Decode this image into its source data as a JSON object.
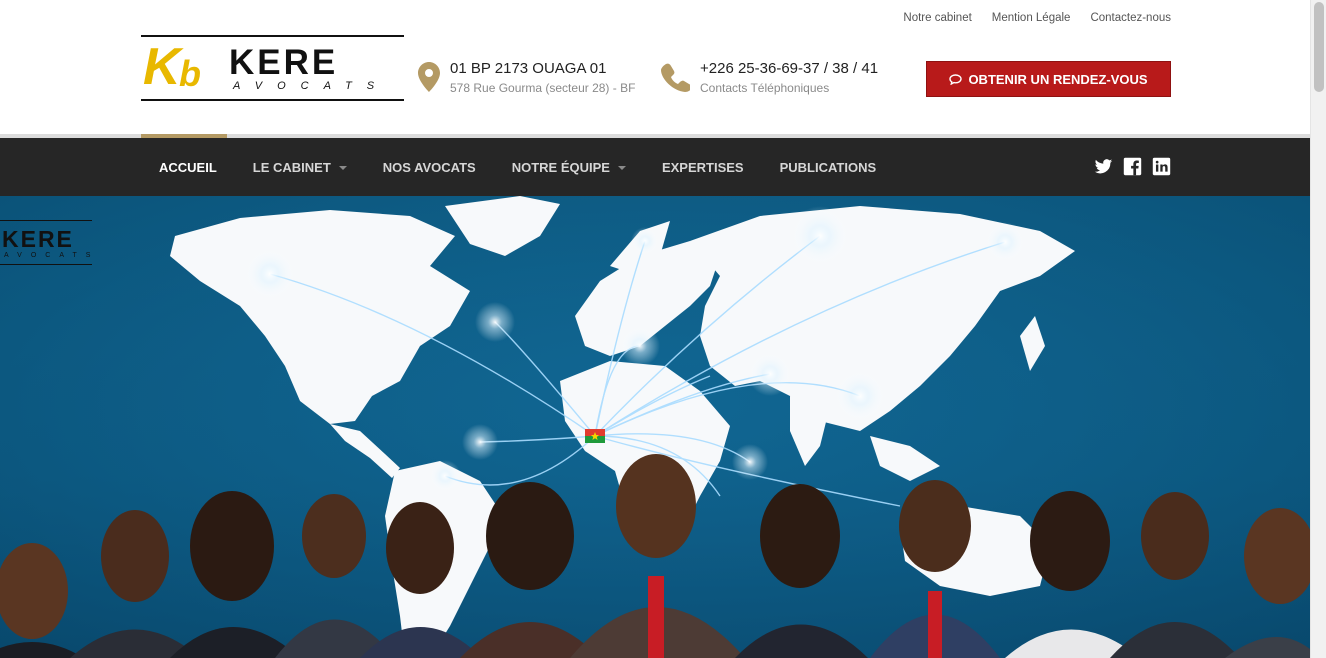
{
  "topbar": {
    "links": [
      "Notre cabinet",
      "Mention Légale",
      "Contactez-nous"
    ]
  },
  "logo": {
    "mark": "Kb",
    "name": "KERE",
    "tagline": "AVOCATS"
  },
  "address": {
    "icon": "map-marker-icon",
    "main": "01 BP 2173 OUAGA 01",
    "sub": "578 Rue Gourma (secteur 28) - BF"
  },
  "phone": {
    "icon": "phone-icon",
    "main": "+226 25-36-69-37 / 38 / 41",
    "sub": "Contacts Téléphoniques"
  },
  "cta": {
    "icon": "chat-bubble-icon",
    "label": "OBTENIR UN RENDEZ-VOUS"
  },
  "nav": {
    "items": [
      {
        "label": "ACCUEIL",
        "active": true,
        "dropdown": false
      },
      {
        "label": "LE CABINET",
        "active": false,
        "dropdown": true
      },
      {
        "label": "NOS AVOCATS",
        "active": false,
        "dropdown": false
      },
      {
        "label": "NOTRE ÉQUIPE",
        "active": false,
        "dropdown": true
      },
      {
        "label": "EXPERTISES",
        "active": false,
        "dropdown": false
      },
      {
        "label": "PUBLICATIONS",
        "active": false,
        "dropdown": false
      }
    ],
    "social": [
      "twitter-icon",
      "facebook-icon",
      "linkedin-icon"
    ]
  },
  "hero": {
    "logo_name": "KERE",
    "logo_tagline": "AVOCATS"
  },
  "colors": {
    "brand_gold": "#e8b800",
    "accent_red": "#b81a1a",
    "nav_bg": "#262626",
    "active_underline": "#b49a64",
    "hero_blue": "#0d5f8a"
  }
}
